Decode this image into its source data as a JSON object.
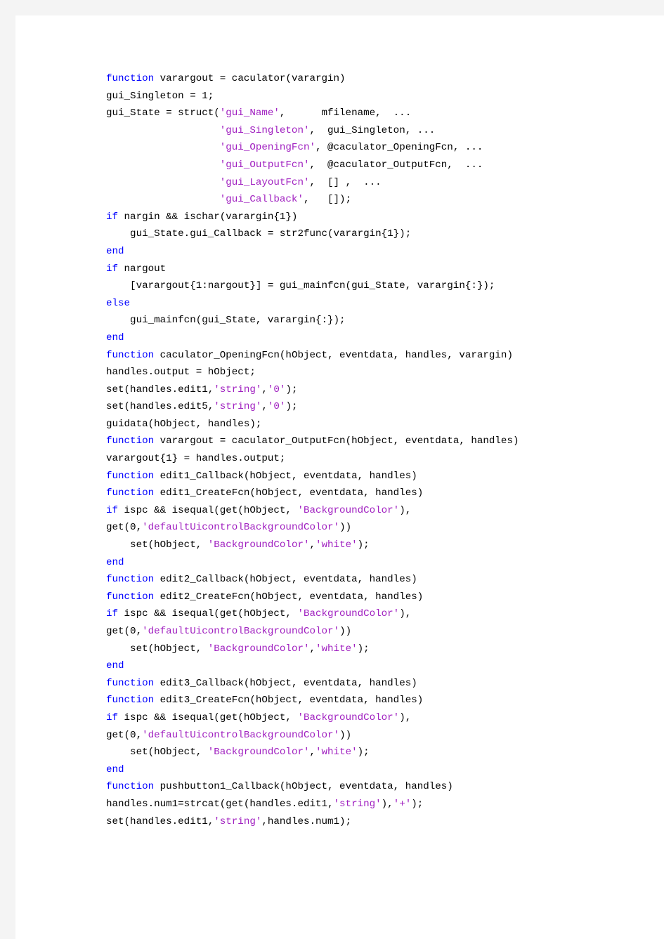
{
  "document": {
    "kind": "matlab-source-listing",
    "title": "caculator.m",
    "language": "MATLAB"
  },
  "colors": {
    "page_background": "#ffffff",
    "margin_background": "#f4f4f4",
    "keyword": "#0000ff",
    "string": "#a020c0",
    "identifier": "#000000"
  },
  "code": {
    "lines": [
      {
        "tokens": [
          {
            "t": "kw",
            "v": "function"
          },
          {
            "t": "id",
            "v": " varargout = caculator(varargin)"
          }
        ]
      },
      {
        "tokens": [
          {
            "t": "id",
            "v": "gui_Singleton = 1;"
          }
        ]
      },
      {
        "tokens": [
          {
            "t": "id",
            "v": "gui_State = struct("
          },
          {
            "t": "str",
            "v": "'gui_Name'"
          },
          {
            "t": "id",
            "v": ",      mfilename,  ..."
          }
        ]
      },
      {
        "tokens": [
          {
            "t": "id",
            "v": "                   "
          },
          {
            "t": "str",
            "v": "'gui_Singleton'"
          },
          {
            "t": "id",
            "v": ",  gui_Singleton, ..."
          }
        ]
      },
      {
        "tokens": [
          {
            "t": "id",
            "v": "                   "
          },
          {
            "t": "str",
            "v": "'gui_OpeningFcn'"
          },
          {
            "t": "id",
            "v": ", @caculator_OpeningFcn, ..."
          }
        ]
      },
      {
        "tokens": [
          {
            "t": "id",
            "v": "                   "
          },
          {
            "t": "str",
            "v": "'gui_OutputFcn'"
          },
          {
            "t": "id",
            "v": ",  @caculator_OutputFcn,  ..."
          }
        ]
      },
      {
        "tokens": [
          {
            "t": "id",
            "v": "                   "
          },
          {
            "t": "str",
            "v": "'gui_LayoutFcn'"
          },
          {
            "t": "id",
            "v": ",  [] ,  ..."
          }
        ]
      },
      {
        "tokens": [
          {
            "t": "id",
            "v": "                   "
          },
          {
            "t": "str",
            "v": "'gui_Callback'"
          },
          {
            "t": "id",
            "v": ",   []);"
          }
        ]
      },
      {
        "tokens": [
          {
            "t": "kw",
            "v": "if"
          },
          {
            "t": "id",
            "v": " nargin && ischar(varargin{1})"
          }
        ]
      },
      {
        "tokens": [
          {
            "t": "id",
            "v": "    gui_State.gui_Callback = str2func(varargin{1});"
          }
        ]
      },
      {
        "tokens": [
          {
            "t": "kw",
            "v": "end"
          }
        ]
      },
      {
        "tokens": [
          {
            "t": "kw",
            "v": "if"
          },
          {
            "t": "id",
            "v": " nargout"
          }
        ]
      },
      {
        "tokens": [
          {
            "t": "id",
            "v": "    [varargout{1:nargout}] = gui_mainfcn(gui_State, varargin{:});"
          }
        ]
      },
      {
        "tokens": [
          {
            "t": "kw",
            "v": "else"
          }
        ]
      },
      {
        "tokens": [
          {
            "t": "id",
            "v": "    gui_mainfcn(gui_State, varargin{:});"
          }
        ]
      },
      {
        "tokens": [
          {
            "t": "kw",
            "v": "end"
          }
        ]
      },
      {
        "tokens": [
          {
            "t": "kw",
            "v": "function"
          },
          {
            "t": "id",
            "v": " caculator_OpeningFcn(hObject, eventdata, handles, varargin)"
          }
        ]
      },
      {
        "tokens": [
          {
            "t": "id",
            "v": "handles.output = hObject;"
          }
        ]
      },
      {
        "tokens": [
          {
            "t": "id",
            "v": "set(handles.edit1,"
          },
          {
            "t": "str",
            "v": "'string'"
          },
          {
            "t": "id",
            "v": ","
          },
          {
            "t": "str",
            "v": "'0'"
          },
          {
            "t": "id",
            "v": ");"
          }
        ]
      },
      {
        "tokens": [
          {
            "t": "id",
            "v": "set(handles.edit5,"
          },
          {
            "t": "str",
            "v": "'string'"
          },
          {
            "t": "id",
            "v": ","
          },
          {
            "t": "str",
            "v": "'0'"
          },
          {
            "t": "id",
            "v": ");"
          }
        ]
      },
      {
        "tokens": [
          {
            "t": "id",
            "v": "guidata(hObject, handles);"
          }
        ]
      },
      {
        "tokens": [
          {
            "t": "kw",
            "v": "function"
          },
          {
            "t": "id",
            "v": " varargout = caculator_OutputFcn(hObject, eventdata, handles)"
          }
        ]
      },
      {
        "tokens": [
          {
            "t": "id",
            "v": "varargout{1} = handles.output;"
          }
        ]
      },
      {
        "tokens": [
          {
            "t": "kw",
            "v": "function"
          },
          {
            "t": "id",
            "v": " edit1_Callback(hObject, eventdata, handles)"
          }
        ]
      },
      {
        "tokens": [
          {
            "t": "kw",
            "v": "function"
          },
          {
            "t": "id",
            "v": " edit1_CreateFcn(hObject, eventdata, handles)"
          }
        ]
      },
      {
        "tokens": [
          {
            "t": "kw",
            "v": "if"
          },
          {
            "t": "id",
            "v": " ispc && isequal(get(hObject, "
          },
          {
            "t": "str",
            "v": "'BackgroundColor'"
          },
          {
            "t": "id",
            "v": "),"
          }
        ]
      },
      {
        "tokens": [
          {
            "t": "id",
            "v": "get(0,"
          },
          {
            "t": "str",
            "v": "'defaultUicontrolBackgroundColor'"
          },
          {
            "t": "id",
            "v": "))"
          }
        ]
      },
      {
        "tokens": [
          {
            "t": "id",
            "v": "    set(hObject, "
          },
          {
            "t": "str",
            "v": "'BackgroundColor'"
          },
          {
            "t": "id",
            "v": ","
          },
          {
            "t": "str",
            "v": "'white'"
          },
          {
            "t": "id",
            "v": ");"
          }
        ]
      },
      {
        "tokens": [
          {
            "t": "kw",
            "v": "end"
          }
        ]
      },
      {
        "tokens": [
          {
            "t": "kw",
            "v": "function"
          },
          {
            "t": "id",
            "v": " edit2_Callback(hObject, eventdata, handles)"
          }
        ]
      },
      {
        "tokens": [
          {
            "t": "kw",
            "v": "function"
          },
          {
            "t": "id",
            "v": " edit2_CreateFcn(hObject, eventdata, handles)"
          }
        ]
      },
      {
        "tokens": [
          {
            "t": "kw",
            "v": "if"
          },
          {
            "t": "id",
            "v": " ispc && isequal(get(hObject, "
          },
          {
            "t": "str",
            "v": "'BackgroundColor'"
          },
          {
            "t": "id",
            "v": "),"
          }
        ]
      },
      {
        "tokens": [
          {
            "t": "id",
            "v": "get(0,"
          },
          {
            "t": "str",
            "v": "'defaultUicontrolBackgroundColor'"
          },
          {
            "t": "id",
            "v": "))"
          }
        ]
      },
      {
        "tokens": [
          {
            "t": "id",
            "v": "    set(hObject, "
          },
          {
            "t": "str",
            "v": "'BackgroundColor'"
          },
          {
            "t": "id",
            "v": ","
          },
          {
            "t": "str",
            "v": "'white'"
          },
          {
            "t": "id",
            "v": ");"
          }
        ]
      },
      {
        "tokens": [
          {
            "t": "kw",
            "v": "end"
          }
        ]
      },
      {
        "tokens": [
          {
            "t": "kw",
            "v": "function"
          },
          {
            "t": "id",
            "v": " edit3_Callback(hObject, eventdata, handles)"
          }
        ]
      },
      {
        "tokens": [
          {
            "t": "kw",
            "v": "function"
          },
          {
            "t": "id",
            "v": " edit3_CreateFcn(hObject, eventdata, handles)"
          }
        ]
      },
      {
        "tokens": [
          {
            "t": "kw",
            "v": "if"
          },
          {
            "t": "id",
            "v": " ispc && isequal(get(hObject, "
          },
          {
            "t": "str",
            "v": "'BackgroundColor'"
          },
          {
            "t": "id",
            "v": "),"
          }
        ]
      },
      {
        "tokens": [
          {
            "t": "id",
            "v": "get(0,"
          },
          {
            "t": "str",
            "v": "'defaultUicontrolBackgroundColor'"
          },
          {
            "t": "id",
            "v": "))"
          }
        ]
      },
      {
        "tokens": [
          {
            "t": "id",
            "v": "    set(hObject, "
          },
          {
            "t": "str",
            "v": "'BackgroundColor'"
          },
          {
            "t": "id",
            "v": ","
          },
          {
            "t": "str",
            "v": "'white'"
          },
          {
            "t": "id",
            "v": ");"
          }
        ]
      },
      {
        "tokens": [
          {
            "t": "kw",
            "v": "end"
          }
        ]
      },
      {
        "tokens": [
          {
            "t": "kw",
            "v": "function"
          },
          {
            "t": "id",
            "v": " pushbutton1_Callback(hObject, eventdata, handles)"
          }
        ]
      },
      {
        "tokens": [
          {
            "t": "id",
            "v": "handles.num1=strcat(get(handles.edit1,"
          },
          {
            "t": "str",
            "v": "'string'"
          },
          {
            "t": "id",
            "v": "),"
          },
          {
            "t": "str",
            "v": "'+'"
          },
          {
            "t": "id",
            "v": ");"
          }
        ]
      },
      {
        "tokens": [
          {
            "t": "id",
            "v": "set(handles.edit1,"
          },
          {
            "t": "str",
            "v": "'string'"
          },
          {
            "t": "id",
            "v": ",handles.num1);"
          }
        ]
      }
    ]
  }
}
